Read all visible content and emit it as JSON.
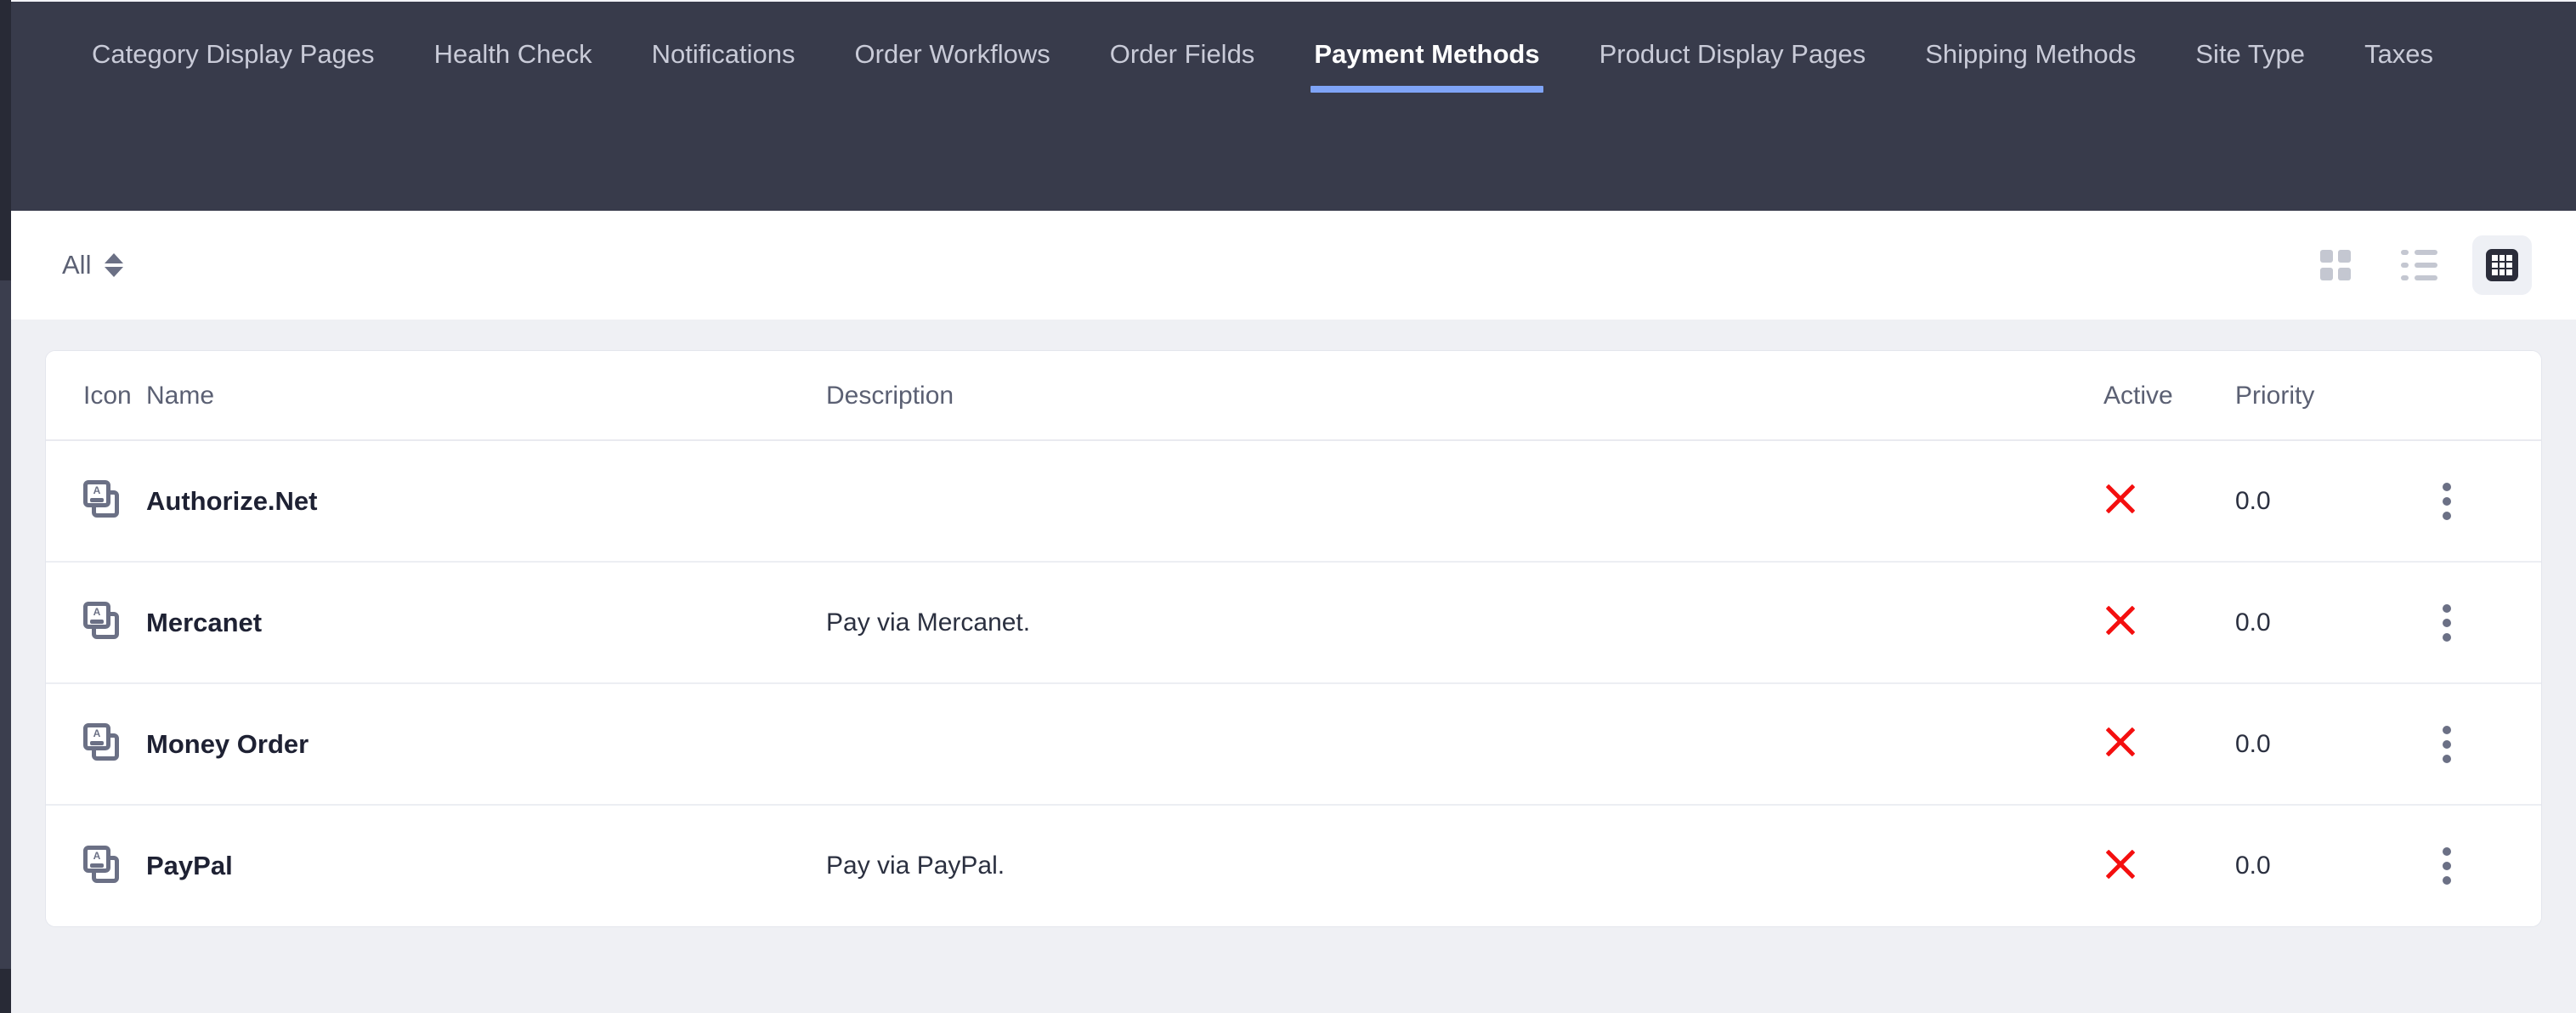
{
  "nav": {
    "tabs": [
      {
        "label": "Category Display Pages",
        "active": false
      },
      {
        "label": "Health Check",
        "active": false
      },
      {
        "label": "Notifications",
        "active": false
      },
      {
        "label": "Order Workflows",
        "active": false
      },
      {
        "label": "Order Fields",
        "active": false
      },
      {
        "label": "Payment Methods",
        "active": true
      },
      {
        "label": "Product Display Pages",
        "active": false
      },
      {
        "label": "Shipping Methods",
        "active": false
      },
      {
        "label": "Site Type",
        "active": false
      },
      {
        "label": "Taxes",
        "active": false
      }
    ],
    "active_underline_color": "#7fa4f7",
    "background_color": "#383b4b"
  },
  "toolbar": {
    "filter_label": "All",
    "sort_icon": "sort-chevrons-icon",
    "views": [
      {
        "name": "cards-view",
        "icon": "grid-cards-icon",
        "active": false
      },
      {
        "name": "list-view",
        "icon": "list-icon",
        "active": false
      },
      {
        "name": "table-view",
        "icon": "table-grid-icon",
        "active": true
      }
    ]
  },
  "table": {
    "columns": [
      "Icon",
      "Name",
      "Description",
      "Active",
      "Priority"
    ],
    "rows": [
      {
        "icon": "copy-document-icon",
        "name": "Authorize.Net",
        "description": "",
        "active": false,
        "active_icon": "red-x-icon",
        "priority": "0.0",
        "menu_icon": "kebab-menu-icon"
      },
      {
        "icon": "copy-document-icon",
        "name": "Mercanet",
        "description": "Pay via Mercanet.",
        "active": false,
        "active_icon": "red-x-icon",
        "priority": "0.0",
        "menu_icon": "kebab-menu-icon"
      },
      {
        "icon": "copy-document-icon",
        "name": "Money Order",
        "description": "",
        "active": false,
        "active_icon": "red-x-icon",
        "priority": "0.0",
        "menu_icon": "kebab-menu-icon"
      },
      {
        "icon": "copy-document-icon",
        "name": "PayPal",
        "description": "Pay via PayPal.",
        "active": false,
        "active_icon": "red-x-icon",
        "priority": "0.0",
        "menu_icon": "kebab-menu-icon"
      }
    ]
  },
  "colors": {
    "nav_bg": "#383b4b",
    "rail_dark": "#282a36",
    "page_bg": "#eff0f4",
    "card_bg": "#ffffff",
    "accent": "#7fa4f7",
    "danger": "#f40f0f",
    "muted_text": "#5b6073"
  }
}
